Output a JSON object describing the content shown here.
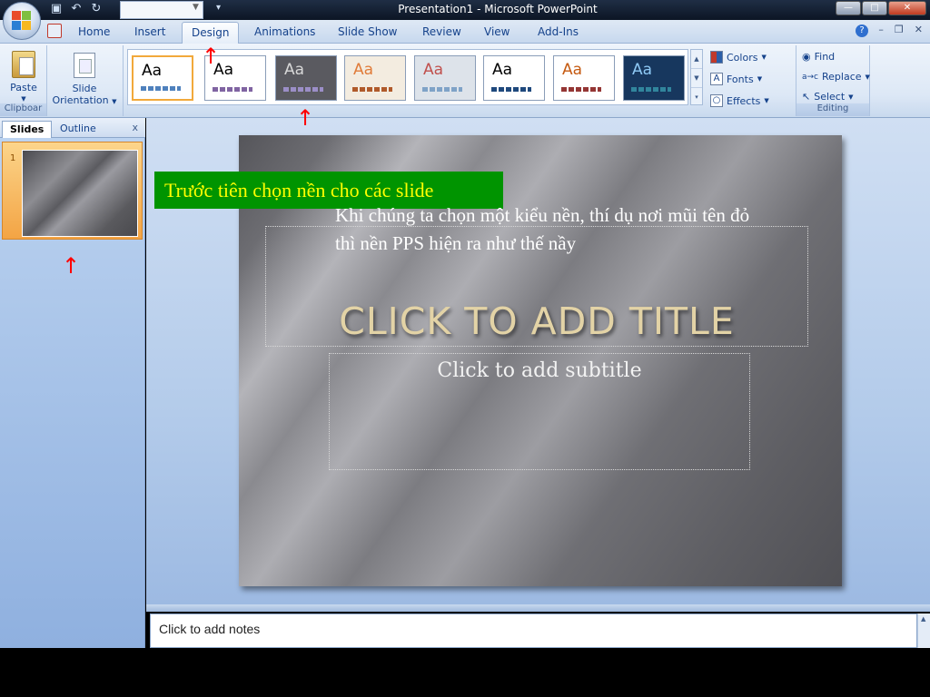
{
  "window": {
    "title": "Presentation1 - Microsoft PowerPoint"
  },
  "ribbon_tabs": [
    {
      "label": "Home"
    },
    {
      "label": "Insert"
    },
    {
      "label": "Design",
      "active": true
    },
    {
      "label": "Animations"
    },
    {
      "label": "Slide Show"
    },
    {
      "label": "Review"
    },
    {
      "label": "View"
    },
    {
      "label": "Add-Ins"
    }
  ],
  "clipboard_group": {
    "paste_label": "Paste",
    "label": "Clipboar"
  },
  "page_setup_group": {
    "slide_label": "Slide",
    "orientation_label": "Orientation"
  },
  "themes": [
    {
      "label": "Aa",
      "bg": "#ffffff",
      "fg": "#000000",
      "bar": "#4f81bd",
      "selected": true
    },
    {
      "label": "Aa",
      "bg": "#ffffff",
      "fg": "#000000",
      "bar": "#8064a2"
    },
    {
      "label": "Aa",
      "bg": "#5a5a60",
      "fg": "#d8d8d8",
      "bar": "#9b8ec7"
    },
    {
      "label": "Aa",
      "bg": "#f3ece0",
      "fg": "#e07b39",
      "bar": "#b05a2a"
    },
    {
      "label": "Aa",
      "bg": "#dde3ea",
      "fg": "#c0504d",
      "bar": "#7fa3c7"
    },
    {
      "label": "Aa",
      "bg": "#ffffff",
      "fg": "#000000",
      "bar": "#1f497d"
    },
    {
      "label": "Aa",
      "bg": "#ffffff",
      "fg": "#c55a11",
      "bar": "#943634"
    },
    {
      "label": "Aa",
      "bg": "#17375e",
      "fg": "#8ec9f5",
      "bar": "#31859c"
    }
  ],
  "theme_options": {
    "colors_label": "Colors",
    "fonts_label": "Fonts",
    "effects_label": "Effects"
  },
  "editing_group": {
    "find_label": "Find",
    "replace_label": "Replace",
    "select_label": "Select",
    "label": "Editing"
  },
  "left_pane": {
    "tab_slides": "Slides",
    "tab_outline": "Outline",
    "close": "x",
    "slide_number": "1"
  },
  "slide": {
    "title_placeholder": "CLICK TO ADD TITLE",
    "subtitle_placeholder": "Click to add subtitle"
  },
  "notes": {
    "placeholder": "Click to add notes"
  },
  "annotations": {
    "banner": "Trước tiên chọn nền cho các slide",
    "caption": "Khi chúng ta chọn một kiểu nền, thí dụ nơi mũi tên đỏ thì nền PPS hiện ra như thế nầy",
    "arrow_glyph": "↑"
  }
}
